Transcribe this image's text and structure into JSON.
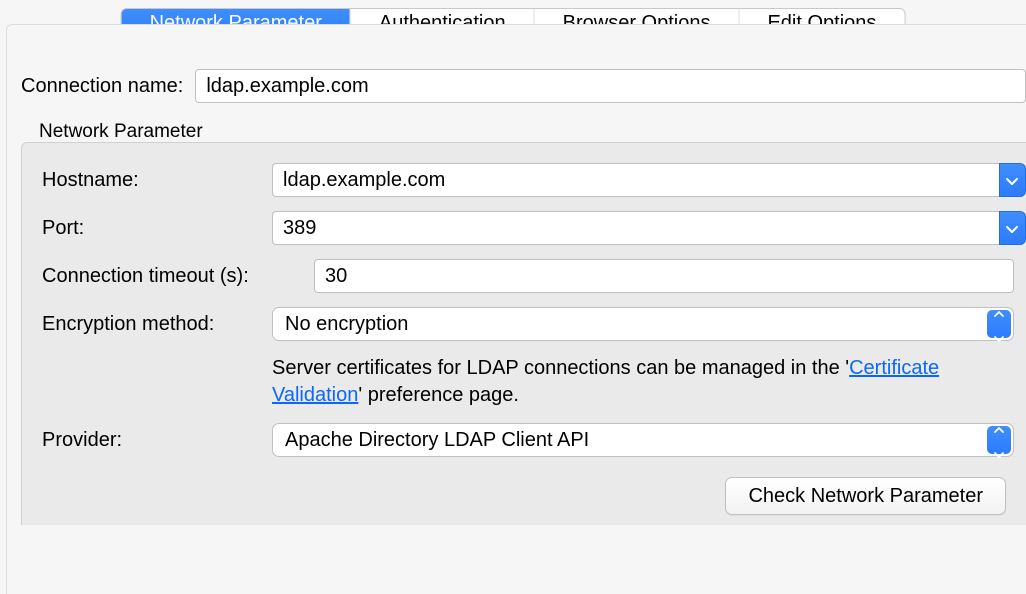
{
  "tabs": {
    "network": "Network Parameter",
    "auth": "Authentication",
    "browser": "Browser Options",
    "edit": "Edit Options"
  },
  "connection_name": {
    "label": "Connection name:",
    "value": "ldap.example.com"
  },
  "group_title": "Network Parameter",
  "fields": {
    "hostname": {
      "label": "Hostname:",
      "value": "ldap.example.com"
    },
    "port": {
      "label": "Port:",
      "value": "389"
    },
    "timeout": {
      "label": "Connection timeout (s):",
      "value": "30"
    },
    "encryption": {
      "label": "Encryption method:",
      "value": "No encryption"
    },
    "provider": {
      "label": "Provider:",
      "value": "Apache Directory LDAP Client API"
    }
  },
  "hint": {
    "before": "Server certificates for LDAP connections can be managed in the '",
    "link": "Certificate Validation",
    "after": "' preference page."
  },
  "check_button": "Check Network Parameter"
}
